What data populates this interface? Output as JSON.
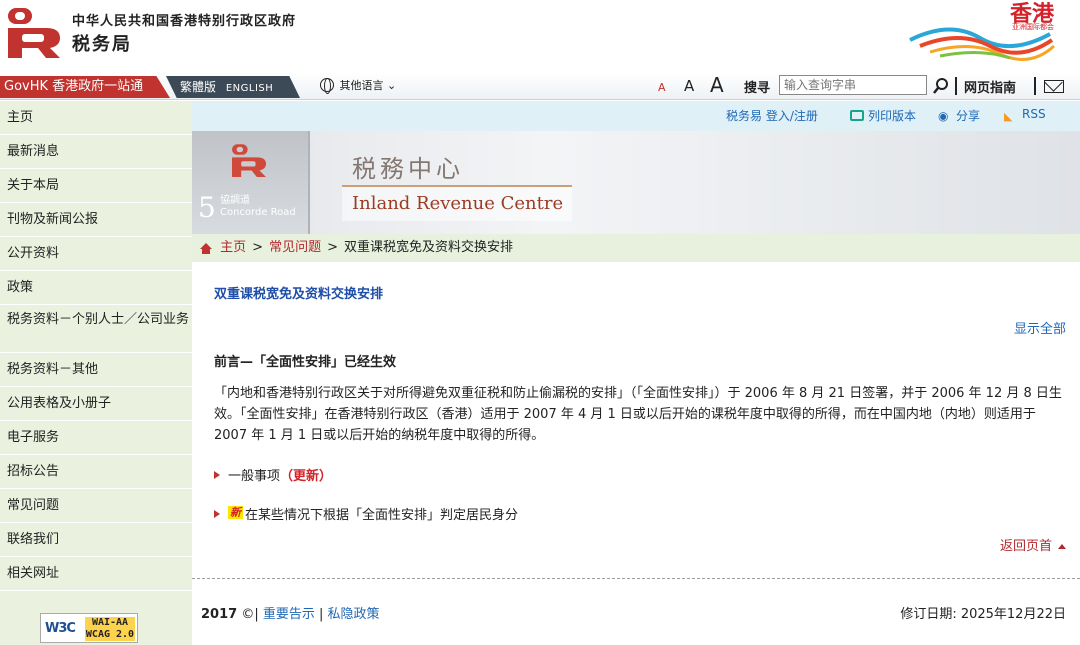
{
  "header": {
    "gov_name": "中华人民共和国香港特别行政区政府",
    "dept_name": "税务局",
    "brand_text": "香港",
    "brand_sub": "亚洲国际都会"
  },
  "topbar": {
    "govhk": "GovHK 香港政府一站通",
    "trad": "繁體版",
    "english": "ENGLISH",
    "other_lang": "其他语言",
    "font_small": "A",
    "font_medium": "A",
    "font_large": "A",
    "search_label": "搜寻",
    "search_placeholder": "输入查询字串",
    "guide": "网页指南"
  },
  "sidebar": {
    "items": [
      "主页",
      "最新消息",
      "关于本局",
      "刊物及新闻公报",
      "公开资料",
      "政策",
      "税务资料－个别人士／公司业务",
      "税务资料－其他",
      "公用表格及小册子",
      "电子服务",
      "招标公告",
      "常见问题",
      "联络我们",
      "相关网址"
    ],
    "wcag_w3c": "W3C",
    "wcag_line1": "WAI-AA",
    "wcag_line2": "WCAG 2.0"
  },
  "utility": {
    "etax": "税务易 登入/注册",
    "print": "列印版本",
    "share": "分享",
    "rss": "RSS"
  },
  "banner": {
    "cn_name": "税務中心",
    "en_name": "Inland Revenue Centre",
    "number": "5",
    "road_cn": "協調道",
    "road_en": "Concorde Road"
  },
  "breadcrumb": {
    "home": "主页",
    "faq": "常见问题",
    "current": "双重课税宽免及资料交换安排"
  },
  "content": {
    "title": "双重课税宽免及资料交换安排",
    "show_all": "显示全部",
    "heading": "前言—「全面性安排」已经生效",
    "intro": "「内地和香港特别行政区关于对所得避免双重征税和防止偷漏税的安排」（「全面性安排」）于 2006 年 8 月 21 日签署，并于 2006 年 12 月 8 日生效。「全面性安排」在香港特别行政区（香港）适用于 2007 年 4 月 1 日或以后开始的课税年度中取得的所得，而在中国内地（内地）则适用于 2007 年 1 月 1 日或以后开始的纳税年度中取得的所得。",
    "item1": "一般事项",
    "item1_badge": "（更新）",
    "item2_new": "新",
    "item2": "在某些情况下根据「全面性安排」判定居民身分",
    "back_top": "返回页首"
  },
  "footer": {
    "year": "2017",
    "copyright": "©|",
    "notice": "重要告示",
    "sep": "|",
    "privacy": "私隐政策",
    "revised": "修订日期: 2025年12月22日"
  },
  "colors": {
    "brand_red": "#c0332e",
    "sidebar_bg": "#eaf1df",
    "link_blue": "#1f68b6"
  }
}
